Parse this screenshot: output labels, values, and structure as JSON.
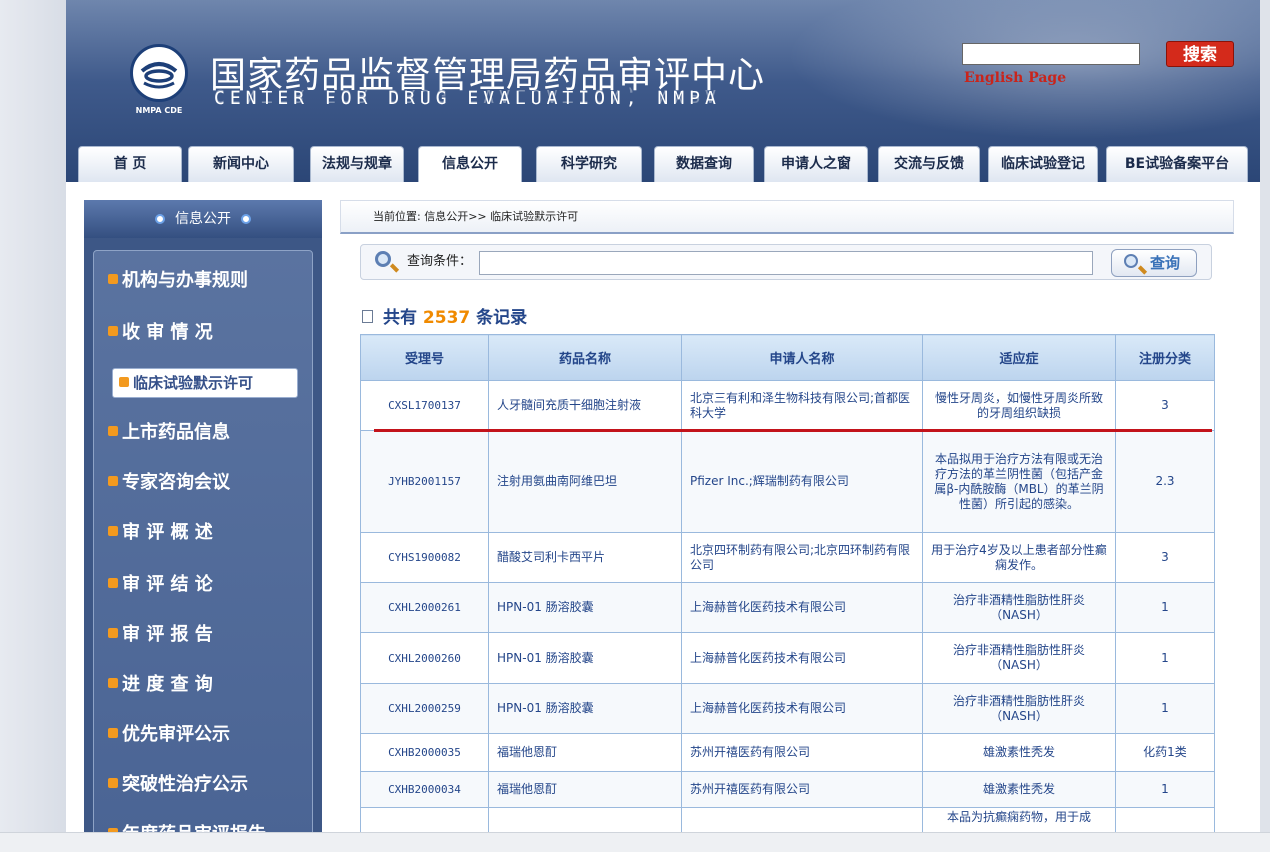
{
  "header": {
    "title": "国家药品监督管理局药品审评中心",
    "subtitle": "CENTER FOR DRUG EVALUATION, NMPA",
    "logo_text": "NMPA CDE",
    "search_button": "搜索",
    "english_link": "English Page"
  },
  "nav": {
    "tabs": [
      "首 页",
      "新闻中心",
      "法规与规章",
      "信息公开",
      "科学研究",
      "数据查询",
      "申请人之窗",
      "交流与反馈",
      "临床试验登记",
      "BE试验备案平台"
    ]
  },
  "sidebar": {
    "title": "信息公开",
    "items": [
      "机构与办事规则",
      "收 审 情 况",
      "临床试验默示许可",
      "上市药品信息",
      "专家咨询会议",
      "审 评 概 述",
      "审 评 结 论",
      "审 评 报 告",
      "进 度 查 询",
      "优先审评公示",
      "突破性治疗公示",
      "年度药品审评报告"
    ]
  },
  "breadcrumb": "当前位置: 信息公开>> 临床试验默示许可",
  "query": {
    "label": "查询条件：",
    "value": "",
    "button": "查询"
  },
  "records": {
    "prefix": "共有",
    "count": "2537",
    "suffix": "条记录"
  },
  "table": {
    "headers": [
      "受理号",
      "药品名称",
      "申请人名称",
      "适应症",
      "注册分类"
    ],
    "rows": [
      [
        "CXSL1700137",
        "人牙髓间充质干细胞注射液",
        "北京三有利和泽生物科技有限公司;首都医科大学",
        "慢性牙周炎，如慢性牙周炎所致的牙周组织缺损",
        "3"
      ],
      [
        "JYHB2001157",
        "注射用氨曲南阿维巴坦",
        "Pfizer Inc.;辉瑞制药有限公司",
        "本品拟用于治疗方法有限或无治疗方法的革兰阴性菌（包括产金属β-内酰胺酶（MBL）的革兰阴性菌）所引起的感染。",
        "2.3"
      ],
      [
        "CYHS1900082",
        "醋酸艾司利卡西平片",
        "北京四环制药有限公司;北京四环制药有限公司",
        "用于治疗4岁及以上患者部分性癫痫发作。",
        "3"
      ],
      [
        "CXHL2000261",
        "HPN-01 肠溶胶囊",
        "上海赫普化医药技术有限公司",
        "治疗非酒精性脂肪性肝炎（NASH）",
        "1"
      ],
      [
        "CXHL2000260",
        "HPN-01 肠溶胶囊",
        "上海赫普化医药技术有限公司",
        "治疗非酒精性脂肪性肝炎（NASH）",
        "1"
      ],
      [
        "CXHL2000259",
        "HPN-01 肠溶胶囊",
        "上海赫普化医药技术有限公司",
        "治疗非酒精性脂肪性肝炎（NASH）",
        "1"
      ],
      [
        "CXHB2000035",
        "福瑞他恩酊",
        "苏州开禧医药有限公司",
        "雄激素性秃发",
        "化药1类"
      ],
      [
        "CXHB2000034",
        "福瑞他恩酊",
        "苏州开禧医药有限公司",
        "雄激素性秃发",
        "1"
      ],
      [
        "",
        "",
        "",
        "本品为抗癫痫药物，用于成",
        ""
      ]
    ]
  },
  "colors": {
    "header_blue": "#3f5a8b",
    "link_blue": "#24468a",
    "count_orange": "#f08a00",
    "search_red": "#d42a1b",
    "highlight_red": "#c3131b"
  }
}
